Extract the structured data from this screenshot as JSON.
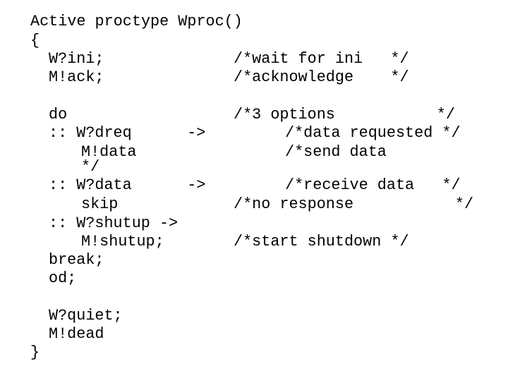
{
  "code": {
    "header": "Active proctype Wproc()",
    "open_brace": "{",
    "stmt_recv_ini": "W?ini;",
    "cmt_wait_ini": "/*wait for ini   */",
    "stmt_send_ack": "M!ack;",
    "cmt_ack": "/*acknowledge    */",
    "kw_do": "do",
    "cmt_options": "/*3 options           */",
    "opt1_guard": ":: W?dreq      ->",
    "cmt_data_requested": "/*data requested */",
    "opt1_action": "M!data",
    "cmt_send_data": "/*send data",
    "cmt_send_data_close": "*/",
    "opt2_guard": ":: W?data      ->",
    "cmt_receive_data": "/*receive data   */",
    "opt2_action": "skip",
    "cmt_no_response": "/*no response           */",
    "opt3_guard": ":: W?shutup ->",
    "opt3_action": "M!shutup;",
    "cmt_start_shutdown": "/*start shutdown */",
    "kw_break": "break;",
    "kw_od": "od;",
    "stmt_recv_quiet": "W?quiet;",
    "stmt_send_dead": "M!dead",
    "close_brace": "}"
  }
}
